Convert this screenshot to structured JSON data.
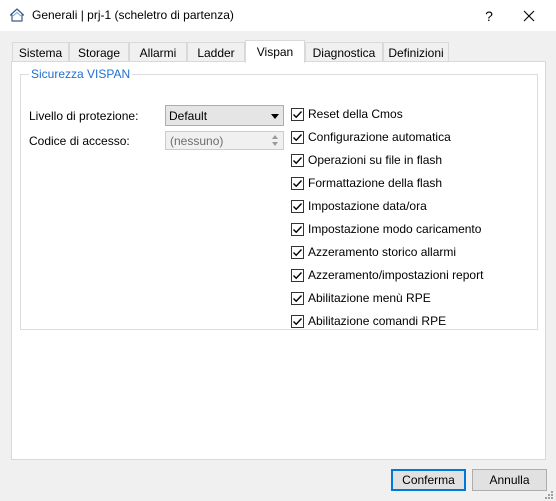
{
  "window": {
    "title": "Generali | prj-1 (scheletro di partenza)",
    "help_label": "?",
    "close_label": "✕",
    "icon": "house-icon"
  },
  "tabs": [
    {
      "label": "Sistema",
      "active": false
    },
    {
      "label": "Storage",
      "active": false
    },
    {
      "label": "Allarmi",
      "active": false
    },
    {
      "label": "Ladder",
      "active": false
    },
    {
      "label": "Vispan",
      "active": true
    },
    {
      "label": "Diagnostica",
      "active": false
    },
    {
      "label": "Definizioni",
      "active": false
    }
  ],
  "group": {
    "title": "Sicurezza VISPAN",
    "protection_label": "Livello di protezione:",
    "protection_value": "Default",
    "access_code_label": "Codice di accesso:",
    "access_code_value": "(nessuno)"
  },
  "checkboxes": [
    {
      "label": "Reset della Cmos",
      "checked": true
    },
    {
      "label": "Configurazione automatica",
      "checked": true
    },
    {
      "label": "Operazioni su file in flash",
      "checked": true
    },
    {
      "label": "Formattazione della flash",
      "checked": true
    },
    {
      "label": "Impostazione data/ora",
      "checked": true
    },
    {
      "label": "Impostazione modo caricamento",
      "checked": true
    },
    {
      "label": "Azzeramento storico allarmi",
      "checked": true
    },
    {
      "label": "Azzeramento/impostazioni report",
      "checked": true
    },
    {
      "label": "Abilitazione menù RPE",
      "checked": true
    },
    {
      "label": "Abilitazione comandi RPE",
      "checked": true
    }
  ],
  "buttons": {
    "confirm": "Conferma",
    "cancel": "Annulla"
  },
  "colors": {
    "accent": "#0078d7",
    "group_title": "#1f6fd0"
  }
}
